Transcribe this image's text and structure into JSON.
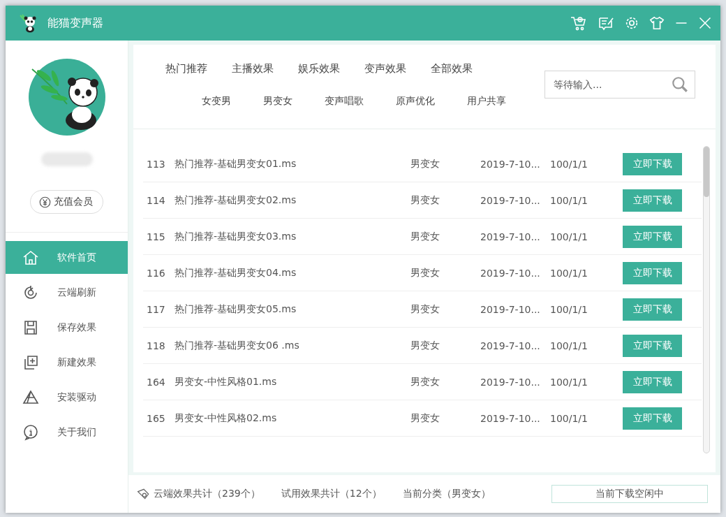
{
  "window": {
    "title": "能猫变声器"
  },
  "sidebar": {
    "recharge_button": "充值会员",
    "items": [
      {
        "label": "软件首页",
        "selected": true
      },
      {
        "label": "云端刷新",
        "selected": false
      },
      {
        "label": "保存效果",
        "selected": false
      },
      {
        "label": "新建效果",
        "selected": false
      },
      {
        "label": "安装驱动",
        "selected": false
      },
      {
        "label": "关于我们",
        "selected": false
      }
    ]
  },
  "tabs": [
    "热门推荐",
    "主播效果",
    "娱乐效果",
    "变声效果",
    "全部效果"
  ],
  "subtabs": [
    "女变男",
    "男变女",
    "变声唱歌",
    "原声优化",
    "用户共享"
  ],
  "search": {
    "placeholder": "等待输入..."
  },
  "rows": [
    {
      "number": "113",
      "name": "热门推荐-基础男变女01.ms",
      "category": "男变女",
      "date": "2019-7-10...",
      "version": "100/1/1",
      "action": "立即下载"
    },
    {
      "number": "114",
      "name": "热门推荐-基础男变女02.ms",
      "category": "男变女",
      "date": "2019-7-10...",
      "version": "100/1/1",
      "action": "立即下载"
    },
    {
      "number": "115",
      "name": "热门推荐-基础男变女03.ms",
      "category": "男变女",
      "date": "2019-7-10...",
      "version": "100/1/1",
      "action": "立即下载"
    },
    {
      "number": "116",
      "name": "热门推荐-基础男变女04.ms",
      "category": "男变女",
      "date": "2019-7-10...",
      "version": "100/1/1",
      "action": "立即下载"
    },
    {
      "number": "117",
      "name": "热门推荐-基础男变女05.ms",
      "category": "男变女",
      "date": "2019-7-10...",
      "version": "100/1/1",
      "action": "立即下载"
    },
    {
      "number": "118",
      "name": "热门推荐-基础男变女06  .ms",
      "category": "男变女",
      "date": "2019-7-10...",
      "version": "100/1/1",
      "action": "立即下载"
    },
    {
      "number": "164",
      "name": "男变女-中性风格01.ms",
      "category": "男变女",
      "date": "2019-7-10...",
      "version": "100/1/1",
      "action": "立即下载"
    },
    {
      "number": "165",
      "name": "男变女-中性风格02.ms",
      "category": "男变女",
      "date": "2019-7-10...",
      "version": "100/1/1",
      "action": "立即下载"
    }
  ],
  "status_bar": {
    "cloud_total": "云端效果共计（239个）",
    "trial_total": "试用效果共计（12个）",
    "current_category": "当前分类（男变女）",
    "download_status": "当前下载空闲中"
  }
}
